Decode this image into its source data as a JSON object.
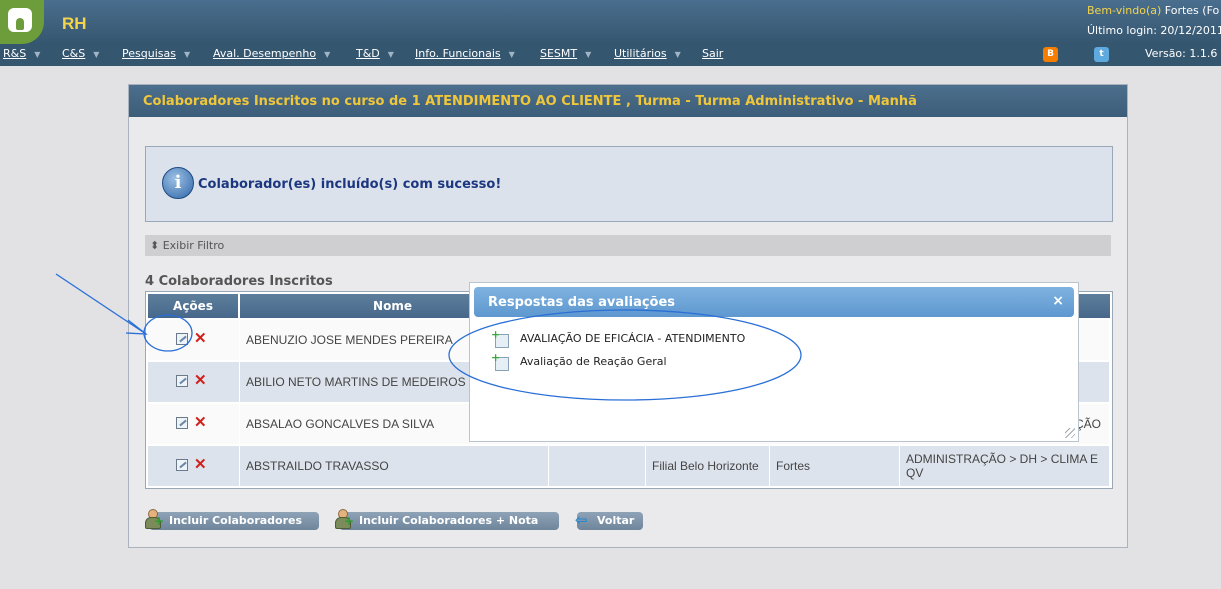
{
  "header": {
    "app_title": "RH",
    "welcome_prefix": "Bem-vindo(a)",
    "welcome_user": " Fortes (Fo",
    "last_login": "Último login: 20/12/2011",
    "version": "Versão: 1.1.6"
  },
  "menu": [
    {
      "label": "R&S"
    },
    {
      "label": "C&S"
    },
    {
      "label": "Pesquisas"
    },
    {
      "label": "Aval. Desempenho"
    },
    {
      "label": "T&D"
    },
    {
      "label": "Info. Funcionais"
    },
    {
      "label": "SESMT"
    },
    {
      "label": "Utilitários"
    },
    {
      "label": "Sair"
    }
  ],
  "menu_arrow": "▼",
  "panel": {
    "title": "Colaboradores Inscritos no curso de 1 ATENDIMENTO AO CLIENTE , Turma - Turma Administrativo - Manhã"
  },
  "message": {
    "icon": "info-icon",
    "text": "Colaborador(es) incluído(s) com sucesso!"
  },
  "filter": {
    "label": "Exibir Filtro",
    "toggle": "⬍"
  },
  "list": {
    "count_label": "4 Colaboradores Inscritos",
    "columns": [
      "Ações",
      "Nome"
    ],
    "rows": [
      {
        "name": "ABENUZIO JOSE MENDES PEREIRA",
        "col3": "",
        "col4": "",
        "col5": "",
        "col6": ""
      },
      {
        "name": "ABILIO NETO MARTINS DE MEDEIROS",
        "col3": "",
        "col4": "",
        "col5": "",
        "col6": ""
      },
      {
        "name": "ABSALAO GONCALVES DA SILVA",
        "col3": "",
        "col4": "",
        "col5": "",
        "col6": "ÇÃO"
      },
      {
        "name": "ABSTRAILDO TRAVASSO",
        "col3": "",
        "col4": "Filial Belo Horizonte",
        "col5": "Fortes",
        "col6": "ADMINISTRAÇÃO > DH > CLIMA E QV"
      }
    ],
    "delete_glyph": "✕"
  },
  "modal": {
    "title": "Respostas das avaliações",
    "close_glyph": "×",
    "items": [
      {
        "label": "AVALIAÇÃO DE EFICÁCIA - ATENDIMENTO"
      },
      {
        "label": "Avaliação de Reação Geral"
      }
    ]
  },
  "buttons": {
    "add": "Incluir Colaboradores",
    "add_grade": "Incluir Colaboradores + Nota",
    "back": "Voltar",
    "back_glyph": "⇦"
  },
  "colors": {
    "header_bg": "#3c5d79",
    "title_yellow": "#f0c73a",
    "annotation_blue": "#2a6fd6"
  }
}
